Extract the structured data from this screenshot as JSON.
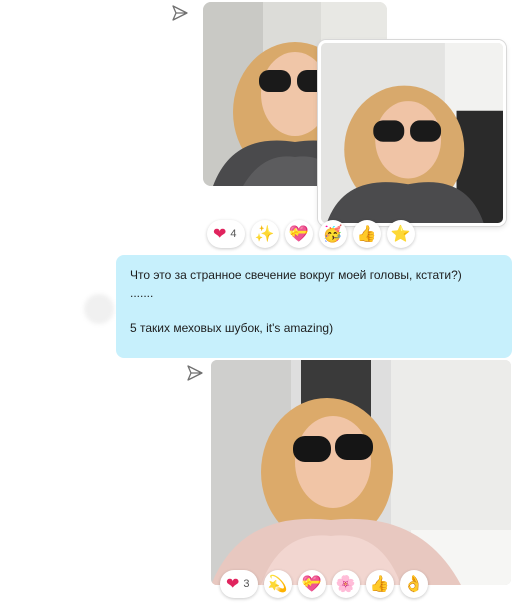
{
  "messages": [
    {
      "type": "photos",
      "reactions": [
        {
          "emoji": "❤",
          "count": "4",
          "color": "#e0245e"
        },
        {
          "emoji": "✨"
        },
        {
          "emoji": "💝"
        },
        {
          "emoji": "🥳"
        },
        {
          "emoji": "👍"
        },
        {
          "emoji": "⭐"
        }
      ]
    },
    {
      "type": "text",
      "lines": [
        "Что это за странное свечение вокруг моей головы, кстати?)",
        ".......",
        "",
        "5 таких меховых шубок, it's amazing)"
      ],
      "bubble_color": "#c7f0fc"
    },
    {
      "type": "photo",
      "reactions": [
        {
          "emoji": "❤",
          "count": "3",
          "color": "#e0245e"
        },
        {
          "emoji": "💫"
        },
        {
          "emoji": "💝"
        },
        {
          "emoji": "🌸"
        },
        {
          "emoji": "👍"
        },
        {
          "emoji": "👌"
        }
      ]
    }
  ]
}
